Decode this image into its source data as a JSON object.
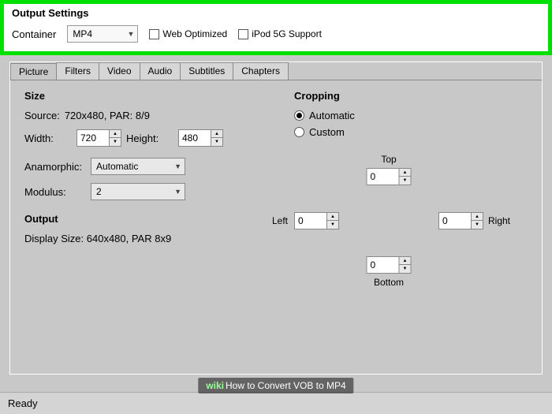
{
  "highlight": {
    "title": "Output Settings",
    "container_label": "Container",
    "container_value": "MP4",
    "web_optimized": "Web Optimized",
    "ipod_support": "iPod 5G Support"
  },
  "tabs": [
    "Picture",
    "Filters",
    "Video",
    "Audio",
    "Subtitles",
    "Chapters"
  ],
  "size": {
    "title": "Size",
    "source_label": "Source:",
    "source_value": "720x480, PAR: 8/9",
    "width_label": "Width:",
    "width_value": "720",
    "height_label": "Height:",
    "height_value": "480",
    "anamorphic_label": "Anamorphic:",
    "anamorphic_value": "Automatic",
    "modulus_label": "Modulus:",
    "modulus_value": "2"
  },
  "output": {
    "title": "Output",
    "display": "Display Size: 640x480,  PAR 8x9"
  },
  "cropping": {
    "title": "Cropping",
    "automatic": "Automatic",
    "custom": "Custom",
    "top": "Top",
    "bottom": "Bottom",
    "left": "Left",
    "right": "Right",
    "val_top": "0",
    "val_bottom": "0",
    "val_left": "0",
    "val_right": "0"
  },
  "status": "Ready",
  "watermark": {
    "brand1": "wiki",
    "brand2": "How to Convert VOB to MP4"
  }
}
